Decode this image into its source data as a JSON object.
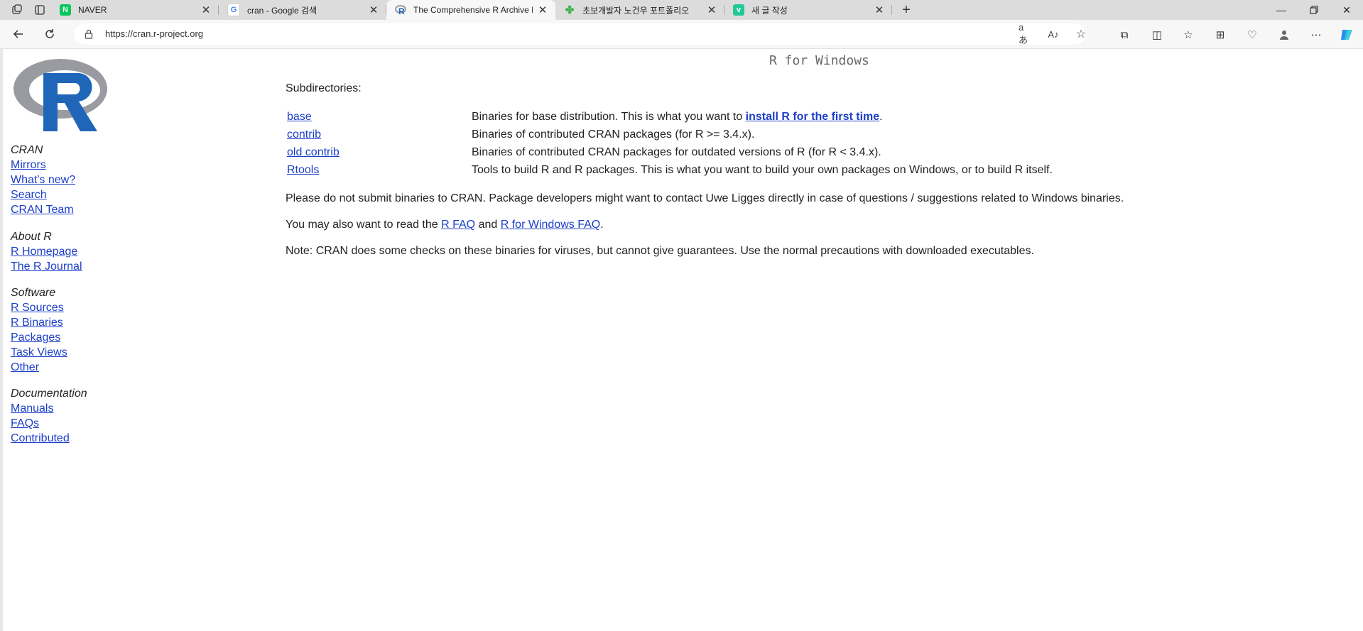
{
  "browser": {
    "tabs": [
      {
        "title": "NAVER",
        "favicon": "naver-icon",
        "color": "#03c75a",
        "active": false
      },
      {
        "title": "cran - Google 검색",
        "favicon": "google-icon",
        "color": "#4285f4",
        "active": false
      },
      {
        "title": "The Comprehensive R Archive Ne",
        "favicon": "r-logo-icon",
        "color": "#2066b8",
        "active": true
      },
      {
        "title": "초보개발자 노건우 포트폴리오",
        "favicon": "clover-icon",
        "color": "#3bb34a",
        "active": false
      },
      {
        "title": "새 글 작성",
        "favicon": "v-icon",
        "color": "#20c997",
        "active": false
      }
    ],
    "url": "https://cran.r-project.org"
  },
  "sidebar": {
    "groups": [
      {
        "heading": "CRAN",
        "links": [
          "Mirrors",
          "What's new?",
          "Search",
          "CRAN Team"
        ]
      },
      {
        "heading": "About R",
        "links": [
          "R Homepage",
          "The R Journal"
        ]
      },
      {
        "heading": "Software",
        "links": [
          "R Sources",
          "R Binaries",
          "Packages",
          "Task Views",
          "Other"
        ]
      },
      {
        "heading": "Documentation",
        "links": [
          "Manuals",
          "FAQs",
          "Contributed"
        ]
      }
    ]
  },
  "main": {
    "title": "R for Windows",
    "subdirectories_label": "Subdirectories:",
    "dirs": [
      {
        "name": "base",
        "desc_pre": "Binaries for base distribution. This is what you want to ",
        "desc_link": "install R for the first time",
        "desc_post": "."
      },
      {
        "name": "contrib",
        "desc": "Binaries of contributed CRAN packages (for R >= 3.4.x)."
      },
      {
        "name": "old contrib",
        "desc": "Binaries of contributed CRAN packages for outdated versions of R (for R < 3.4.x)."
      },
      {
        "name": "Rtools",
        "desc": "Tools to build R and R packages. This is what you want to build your own packages on Windows, or to build R itself."
      }
    ],
    "note1": "Please do not submit binaries to CRAN. Package developers might want to contact Uwe Ligges directly in case of questions / suggestions related to Windows binaries.",
    "note2_pre": "You may also want to read the ",
    "note2_link1": "R FAQ",
    "note2_mid": " and ",
    "note2_link2": "R for Windows FAQ",
    "note2_post": ".",
    "note3": "Note: CRAN does some checks on these binaries for viruses, but cannot give guarantees. Use the normal precautions with downloaded executables."
  },
  "colors": {
    "link": "#1c3fc9",
    "r_blue": "#2066b8",
    "r_grey": "#9a9ba0"
  }
}
